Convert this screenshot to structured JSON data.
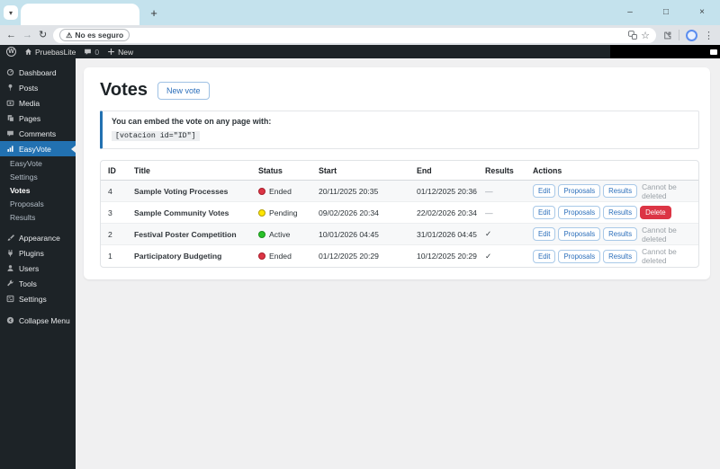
{
  "colors": {
    "accent": "#2271b1",
    "danger": "#dc3545",
    "adminbar": "#1d2327",
    "tabstrip": "#c4e2ed"
  },
  "icons": {
    "tab_search": "▾",
    "new_tab": "+",
    "back": "←",
    "forward": "→",
    "reload": "↻",
    "warning": "⚠",
    "star": "☆",
    "menu_dots": "⋮",
    "minimize": "–",
    "maximize": "□",
    "close": "×"
  },
  "browser": {
    "security_chip": "No es seguro"
  },
  "admin_bar": {
    "wp_logo": "W",
    "site_name": "PruebasLite",
    "comments_count": "0",
    "new_label": "New"
  },
  "sidebar": {
    "top_items": [
      {
        "label": "Dashboard",
        "icon": "dashboard"
      },
      {
        "label": "Posts",
        "icon": "pin"
      },
      {
        "label": "Media",
        "icon": "media"
      },
      {
        "label": "Pages",
        "icon": "pages"
      },
      {
        "label": "Comments",
        "icon": "comment"
      }
    ],
    "active_item": {
      "label": "EasyVote",
      "icon": "chart"
    },
    "submenu": [
      "EasyVote",
      "Settings",
      "Votes",
      "Proposals",
      "Results"
    ],
    "submenu_current": "Votes",
    "bottom_items": [
      {
        "label": "Appearance",
        "icon": "brush"
      },
      {
        "label": "Plugins",
        "icon": "plug"
      },
      {
        "label": "Users",
        "icon": "user"
      },
      {
        "label": "Tools",
        "icon": "wrench"
      },
      {
        "label": "Settings",
        "icon": "sliders"
      }
    ],
    "collapse": {
      "label": "Collapse Menu",
      "icon": "collapse"
    }
  },
  "page": {
    "title": "Votes",
    "new_vote_button": "New vote",
    "embed_note": "You can embed the vote on any page with:",
    "embed_shortcode": "[votacion id=\"ID\"]"
  },
  "table": {
    "headers": [
      "ID",
      "Title",
      "Status",
      "Start",
      "End",
      "Results",
      "Actions"
    ],
    "action_buttons": [
      "Edit",
      "Proposals",
      "Results"
    ],
    "rows": [
      {
        "id": "4",
        "title": "Sample Voting Processes",
        "status": "Ended",
        "status_fill": "#dc3545",
        "status_border": "#a71d2a",
        "start": "20/11/2025 20:35",
        "end": "01/12/2025 20:36",
        "results": "—",
        "delete_note": "Cannot be deleted",
        "delete_button": null
      },
      {
        "id": "3",
        "title": "Sample Community Votes",
        "status": "Pending",
        "status_fill": "#ffe600",
        "status_border": "#b3a000",
        "start": "09/02/2026 20:34",
        "end": "22/02/2026 20:34",
        "results": "—",
        "delete_note": null,
        "delete_button": "Delete"
      },
      {
        "id": "2",
        "title": "Festival Poster Competition",
        "status": "Active",
        "status_fill": "#28c128",
        "status_border": "#1d8f1d",
        "start": "10/01/2026 04:45",
        "end": "31/01/2026 04:45",
        "results": "✓",
        "delete_note": "Cannot be deleted",
        "delete_button": null
      },
      {
        "id": "1",
        "title": "Participatory Budgeting",
        "status": "Ended",
        "status_fill": "#dc3545",
        "status_border": "#a71d2a",
        "start": "01/12/2025 20:29",
        "end": "10/12/2025 20:29",
        "results": "✓",
        "delete_note": "Cannot be deleted",
        "delete_button": null
      }
    ]
  }
}
